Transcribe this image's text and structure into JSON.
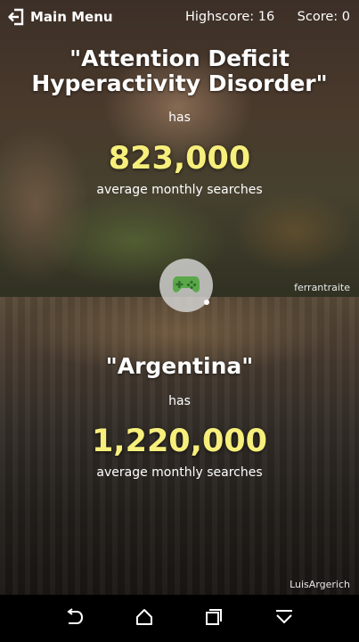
{
  "header": {
    "menu_label": "Main Menu",
    "highscore": "Highscore: 16",
    "score": "Score: 0"
  },
  "top": {
    "term": "\"Attention Deficit Hyperactivity Disorder\"",
    "has": "has",
    "value": "823,000",
    "unit": "average monthly searches",
    "credit": "ferrantraite"
  },
  "bottom": {
    "term": "\"Argentina\"",
    "has": "has",
    "value": "1,220,000",
    "unit": "average monthly searches",
    "credit": "LuisArgerich"
  },
  "icons": {
    "menu": "exit-icon",
    "center": "gamepad-icon",
    "nav": [
      "back-icon",
      "home-icon",
      "recents-icon",
      "collapse-icon"
    ]
  },
  "colors": {
    "value": "#f7ef7c",
    "gamepad": "#5aa84a"
  }
}
